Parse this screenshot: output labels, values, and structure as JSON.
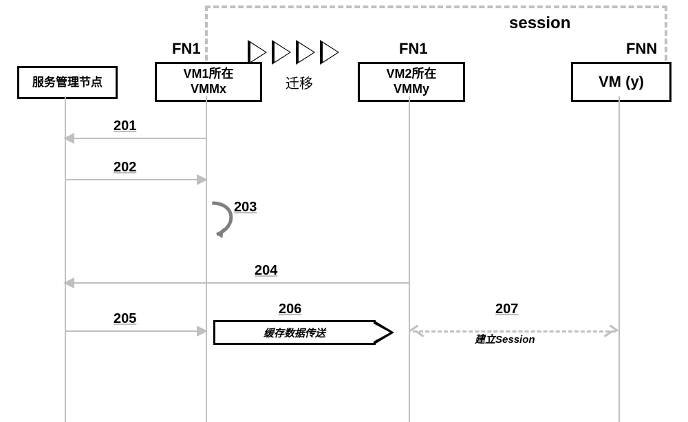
{
  "chart_data": {
    "type": "sequence-diagram",
    "title": "session",
    "migration_label": "迁移",
    "lanes": [
      {
        "id": "mgmt",
        "label": "服务管理节点",
        "top_label": null
      },
      {
        "id": "vmmx",
        "label": "VM1所在\nVMMx",
        "top_label": "FN1"
      },
      {
        "id": "vmmy",
        "label": "VM2所在\nVMMy",
        "top_label": "FN1"
      },
      {
        "id": "vmy",
        "label": "VM (y)",
        "top_label": "FNN"
      }
    ],
    "migration_arrow": {
      "from": "vmmx",
      "to": "vmmy"
    },
    "messages": [
      {
        "num": "201",
        "from": "vmmx",
        "to": "mgmt",
        "style": "solid"
      },
      {
        "num": "202",
        "from": "mgmt",
        "to": "vmmx",
        "style": "solid"
      },
      {
        "num": "203",
        "from": "vmmx",
        "to": "vmmx",
        "style": "self"
      },
      {
        "num": "204",
        "from": "vmmy",
        "to": "mgmt",
        "style": "solid"
      },
      {
        "num": "205",
        "from": "mgmt",
        "to": "vmmx",
        "style": "solid"
      },
      {
        "num": "206",
        "from": "vmmx",
        "to": "vmmy",
        "style": "block-arrow",
        "label": "缓存数据传送"
      },
      {
        "num": "207",
        "from": "vmmy",
        "to": "vmy",
        "style": "dashed-open",
        "label": "建立Session"
      }
    ],
    "session_group": [
      "vmmx",
      "vmmy",
      "vmy"
    ]
  },
  "labels": {
    "session": "session",
    "fn1a": "FN1",
    "fn1b": "FN1",
    "fnn": "FNN",
    "mgmt": "服务管理节点",
    "vmmx_l1": "VM1所在",
    "vmmx_l2": "VMMx",
    "vmmy_l1": "VM2所在",
    "vmmy_l2": "VMMy",
    "vmy": "VM (y)",
    "migrate": "迁移",
    "m201": "201",
    "m202": "202",
    "m203": "203",
    "m204": "204",
    "m205": "205",
    "m206": "206",
    "m207": "207",
    "cache_transfer": "缓存数据传送",
    "establish_session": "建立Session"
  }
}
